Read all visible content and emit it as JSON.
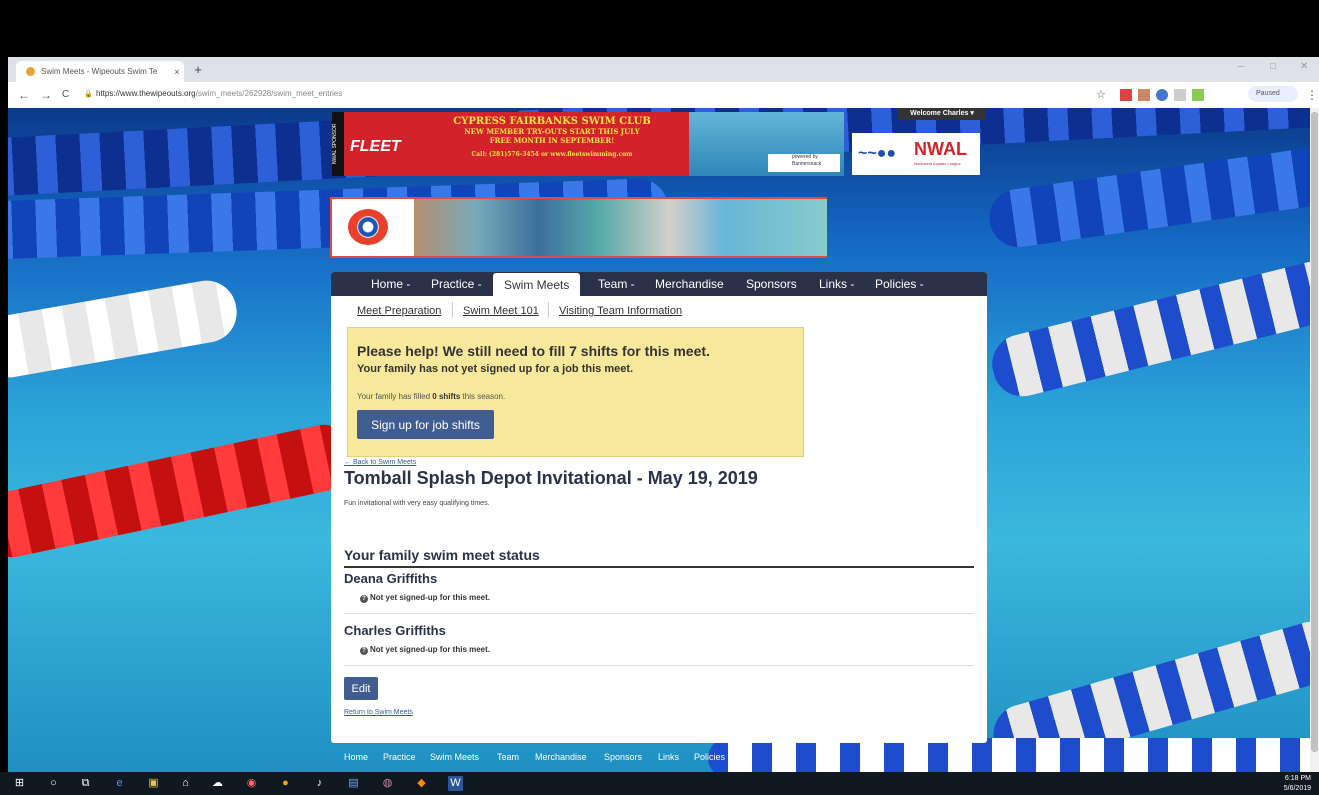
{
  "browser": {
    "tab_title": "Swim Meets - Wipeouts Swim Te",
    "tab_close": "×",
    "new_tab": "+",
    "url_host": "https://www.thewipeouts.org",
    "url_path": "/swim_meets/262928/swim_meet_entries",
    "paused_label": "Paused",
    "win_min": "–",
    "win_max": "□",
    "win_close": "✕",
    "back_glyph": "←",
    "forward_glyph": "→",
    "reload_glyph": "C",
    "lock_glyph": "🔒",
    "star_glyph": "☆",
    "menu_glyph": "⋮"
  },
  "banners": {
    "sponsor_vertical": "NWAL SPONSOR",
    "fleet": "FLEET",
    "club_line1": "CYPRESS FAIRBANKS SWIM CLUB",
    "club_line2": "NEW MEMBER TRY-OUTS START THIS JULY",
    "club_line3": "FREE MONTH IN SEPTEMBER!",
    "club_line4": "Call: (281)576-3454 or www.fleetswimming.com",
    "powered_by": "powered by Bannersnack",
    "welcome": "Welcome Charles ▾",
    "nwal_waves": "~~●●",
    "nwal_logo": "NWAL",
    "nwal_sub": "Northwest Aquatic League"
  },
  "mainnav": [
    {
      "label": "Home -"
    },
    {
      "label": "Practice -"
    },
    {
      "label": "Swim Meets"
    },
    {
      "label": "Team -"
    },
    {
      "label": "Merchandise"
    },
    {
      "label": "Sponsors"
    },
    {
      "label": "Links -"
    },
    {
      "label": "Policies -"
    }
  ],
  "subnav": [
    {
      "label": "Meet Preparation"
    },
    {
      "label": "Swim Meet 101"
    },
    {
      "label": "Visiting Team Information"
    }
  ],
  "alert": {
    "heading": "Please help! We still need to fill 7 shifts for this meet.",
    "subheading": "Your family has not yet signed up for a job this meet.",
    "filled_prefix": "Your family has filled ",
    "filled_bold": "0 shifts",
    "filled_suffix": " this season.",
    "button": "Sign up for job shifts"
  },
  "meet": {
    "back_link": "← Back to Swim Meets",
    "title": "Tomball Splash Depot Invitational - May 19, 2019",
    "description": "Fun invitational with very easy qualifying times."
  },
  "status": {
    "heading": "Your family swim meet status",
    "q_glyph": "?",
    "swimmers": [
      {
        "name": "Deana Griffiths",
        "status": "Not yet signed-up for this meet."
      },
      {
        "name": "Charles Griffiths",
        "status": "Not yet signed-up for this meet."
      }
    ],
    "edit_button": "Edit",
    "return_link": "Return to Swim Meets"
  },
  "footer_nav": [
    "Home",
    "Practice",
    "Swim Meets",
    "Team",
    "Merchandise",
    "Sponsors",
    "Links",
    "Policies"
  ],
  "taskbar": {
    "time": "6:18 PM",
    "date": "5/6/2019",
    "icons": [
      "⊞",
      "○",
      "⧉",
      "e",
      "▣",
      "⌂",
      "☁",
      "◉",
      "●",
      "♪",
      "▤",
      "◍",
      "◆",
      "W"
    ]
  }
}
